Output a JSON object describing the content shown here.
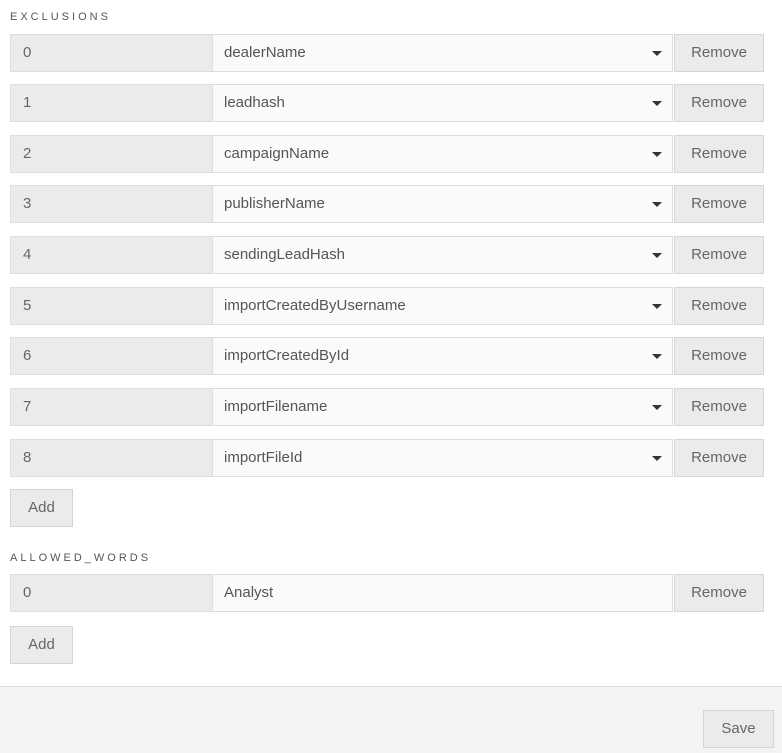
{
  "exclusions": {
    "title": "EXCLUSIONS",
    "rows": [
      {
        "index": "0",
        "value": "dealerName",
        "remove_label": "Remove"
      },
      {
        "index": "1",
        "value": "leadhash",
        "remove_label": "Remove"
      },
      {
        "index": "2",
        "value": "campaignName",
        "remove_label": "Remove"
      },
      {
        "index": "3",
        "value": "publisherName",
        "remove_label": "Remove"
      },
      {
        "index": "4",
        "value": "sendingLeadHash",
        "remove_label": "Remove"
      },
      {
        "index": "5",
        "value": "importCreatedByUsername",
        "remove_label": "Remove"
      },
      {
        "index": "6",
        "value": "importCreatedById",
        "remove_label": "Remove"
      },
      {
        "index": "7",
        "value": "importFilename",
        "remove_label": "Remove"
      },
      {
        "index": "8",
        "value": "importFileId",
        "remove_label": "Remove"
      }
    ],
    "add_label": "Add"
  },
  "allowed_words": {
    "title": "ALLOWED_WORDS",
    "rows": [
      {
        "index": "0",
        "value": "Analyst",
        "remove_label": "Remove"
      }
    ],
    "add_label": "Add"
  },
  "footer": {
    "save_label": "Save"
  }
}
